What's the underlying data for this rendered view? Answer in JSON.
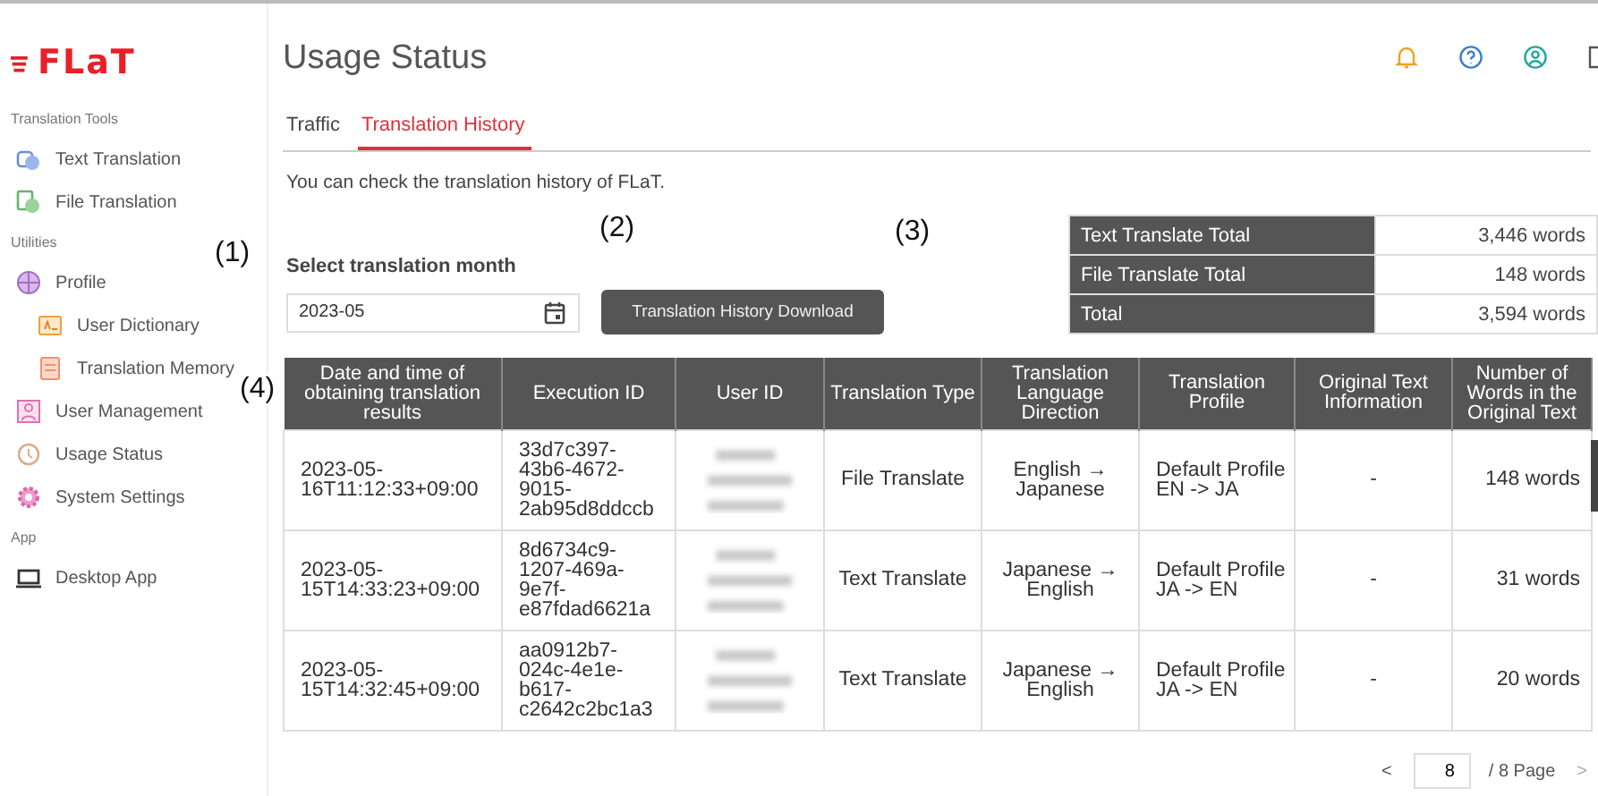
{
  "logo": "FLaT",
  "sidebar": {
    "sections": [
      {
        "heading": "Translation Tools",
        "items": [
          {
            "label": "Text Translation",
            "kind": "text"
          },
          {
            "label": "File Translation",
            "kind": "file"
          }
        ]
      },
      {
        "heading": "Utilities",
        "items": [
          {
            "label": "Profile",
            "kind": "profile",
            "children": [
              {
                "label": "User Dictionary",
                "kind": "dictionary"
              },
              {
                "label": "Translation Memory",
                "kind": "memory"
              }
            ]
          },
          {
            "label": "User Management",
            "kind": "users"
          },
          {
            "label": "Usage Status",
            "kind": "usage"
          },
          {
            "label": "System Settings",
            "kind": "settings"
          }
        ]
      },
      {
        "heading": "App",
        "items": [
          {
            "label": "Desktop App",
            "kind": "desktop"
          }
        ]
      }
    ]
  },
  "page_title": "Usage Status",
  "tabs": [
    {
      "label": "Traffic",
      "selected": false
    },
    {
      "label": "Translation History",
      "selected": true
    }
  ],
  "description": "You can check the translation history of FLaT.",
  "month": {
    "label": "Select translation month",
    "value": "2023-05"
  },
  "download_button": "Translation History Download",
  "summary": [
    {
      "label": "Text Translate Total",
      "value": "3,446 words"
    },
    {
      "label": "File Translate Total",
      "value": "148 words"
    },
    {
      "label": "Total",
      "value": "3,594 words"
    }
  ],
  "callouts": [
    "(1)",
    "(2)",
    "(3)",
    "(4)"
  ],
  "table": {
    "columns": [
      "Date and time of obtaining translation results",
      "Execution ID",
      "User ID",
      "Translation Type",
      "Translation Language Direction",
      "Translation Profile",
      "Original Text Information",
      "Number of Words in the Original Text"
    ],
    "rows": [
      {
        "datetime": "2023-05-16T11:12:33+09:00",
        "execution_id": "33d7c397-43b6-4672-9015-2ab95d8ddccb",
        "type": "File Translate",
        "direction": "English → Japanese",
        "profile": "Default Profile EN -> JA",
        "original_info": "-",
        "words": "148 words"
      },
      {
        "datetime": "2023-05-15T14:33:23+09:00",
        "execution_id": "8d6734c9-1207-469a-9e7f-e87fdad6621a",
        "type": "Text Translate",
        "direction": "Japanese → English",
        "profile": "Default Profile JA -> EN",
        "original_info": "-",
        "words": "31 words"
      },
      {
        "datetime": "2023-05-15T14:32:45+09:00",
        "execution_id": "aa0912b7-024c-4e1e-b617-c2642c2bc1a3",
        "type": "Text Translate",
        "direction": "Japanese → English",
        "profile": "Default Profile JA -> EN",
        "original_info": "-",
        "words": "20 words"
      }
    ]
  },
  "pagination": {
    "prev": "<",
    "page": "8",
    "total": "/ 8 Page",
    "next": ">"
  }
}
